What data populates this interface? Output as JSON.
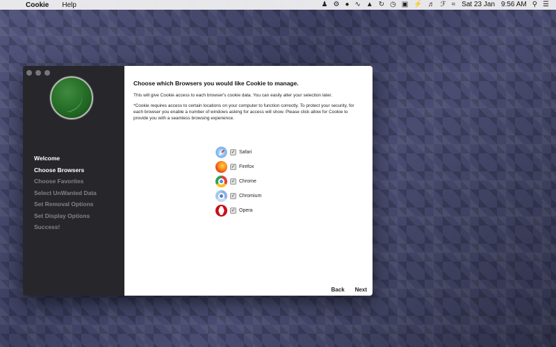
{
  "menubar": {
    "app_name": "Cookie",
    "menus": [
      "Help"
    ],
    "date": "Sat 23 Jan",
    "time": "9:56 AM"
  },
  "sidebar": {
    "steps": [
      {
        "label": "Welcome",
        "state": "done"
      },
      {
        "label": "Choose Browsers",
        "state": "active"
      },
      {
        "label": "Choose Favorites",
        "state": "pending"
      },
      {
        "label": "Select UnWanted Data",
        "state": "pending"
      },
      {
        "label": "Set Removal Options",
        "state": "pending"
      },
      {
        "label": "Set Display Options",
        "state": "pending"
      },
      {
        "label": "Success!",
        "state": "pending"
      }
    ]
  },
  "content": {
    "title": "Choose which Browsers you would like Cookie to manage.",
    "intro": "This will give Cookie access to each browser's cookie data. You can easily alter your selection later.",
    "note": "*Cookie requires access to certain locations on your computer to function correctly. To protect your security, for each browser you enable a number of windows asking for access will show. Please click allow for Cookie to provide you with a seamless browsing experience."
  },
  "browsers": [
    {
      "label": "Safari",
      "checked": true,
      "icon": "safari-icon"
    },
    {
      "label": "Firefox",
      "checked": true,
      "icon": "firefox-icon"
    },
    {
      "label": "Chrome",
      "checked": true,
      "icon": "chrome-icon"
    },
    {
      "label": "Chromium",
      "checked": true,
      "icon": "chromium-icon"
    },
    {
      "label": "Opera",
      "checked": true,
      "icon": "opera-icon"
    }
  ],
  "nav": {
    "back_label": "Back",
    "next_label": "Next"
  }
}
